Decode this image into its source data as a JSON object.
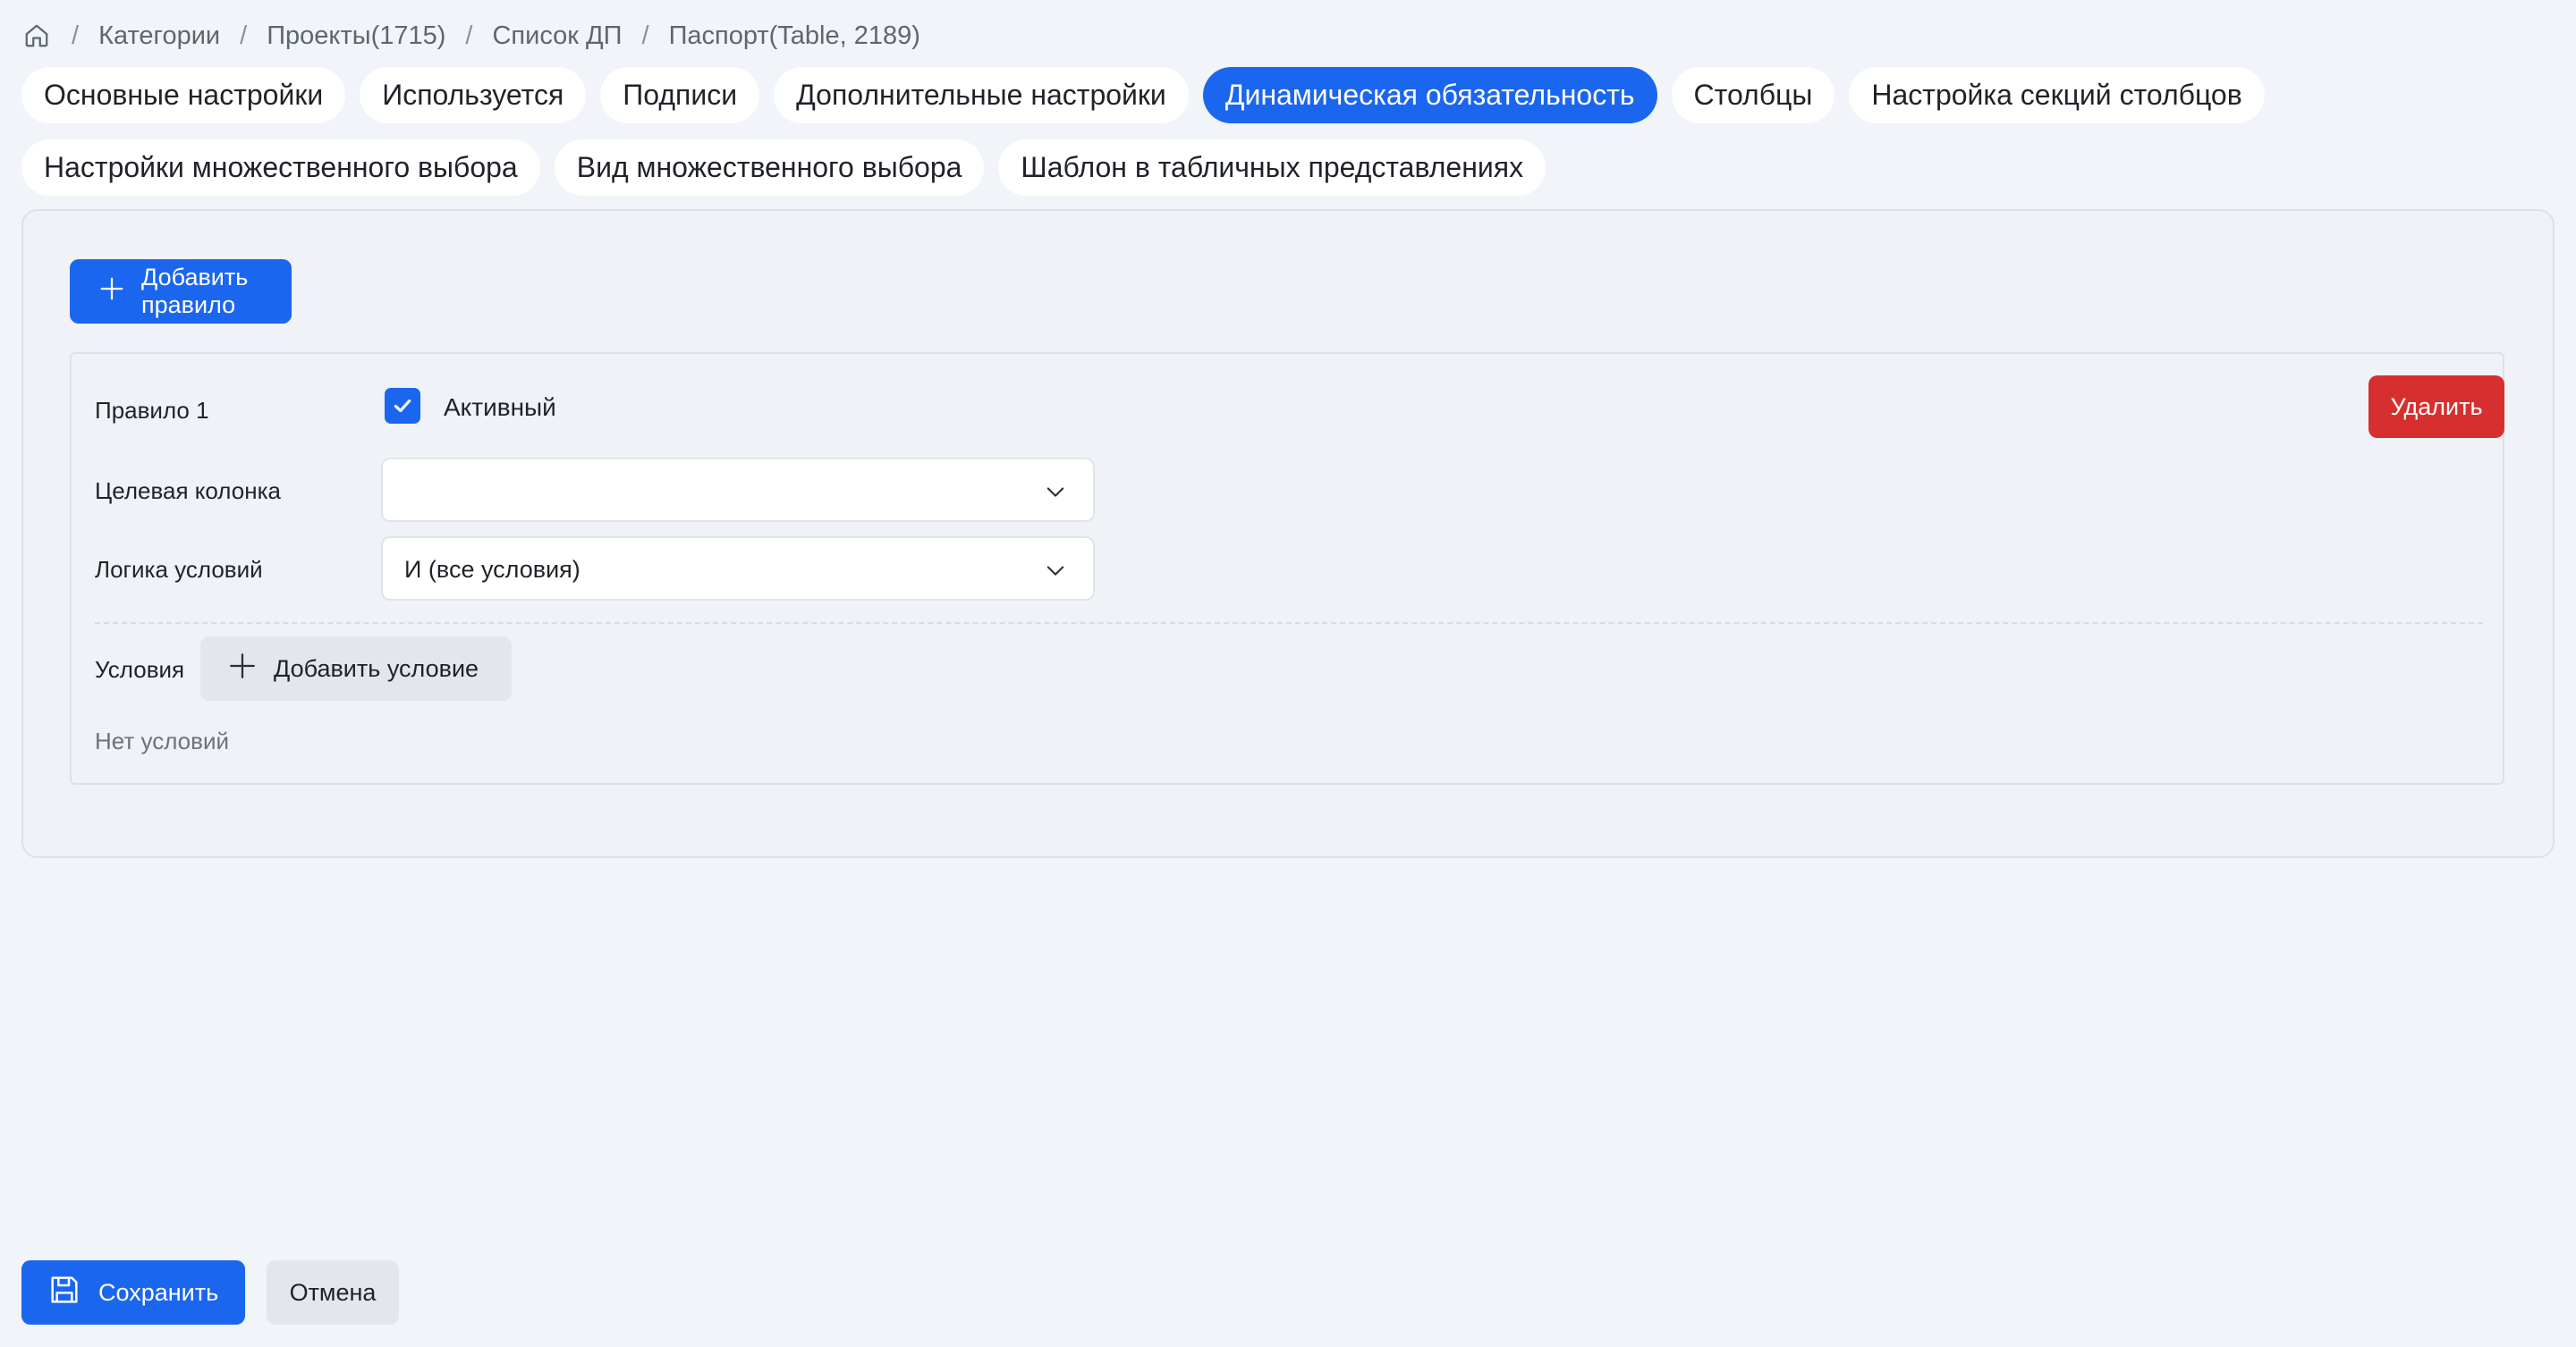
{
  "breadcrumb": {
    "home_icon": "home-icon",
    "items": [
      "Категории",
      "Проекты(1715)",
      "Список ДП",
      "Паспорт(Table, 2189)"
    ],
    "separator": "/"
  },
  "tabs": [
    {
      "label": "Основные настройки",
      "active": false
    },
    {
      "label": "Используется",
      "active": false
    },
    {
      "label": "Подписи",
      "active": false
    },
    {
      "label": "Дополнительные настройки",
      "active": false
    },
    {
      "label": "Динамическая обязательность",
      "active": true
    },
    {
      "label": "Столбцы",
      "active": false
    },
    {
      "label": "Настройка секций столбцов",
      "active": false
    },
    {
      "label": "Настройки множественного выбора",
      "active": false
    },
    {
      "label": "Вид множественного выбора",
      "active": false
    },
    {
      "label": "Шаблон в табличных представлениях",
      "active": false
    }
  ],
  "panel": {
    "add_rule_label": "Добавить правило",
    "rule": {
      "title": "Правило 1",
      "active_label": "Активный",
      "active_checked": true,
      "delete_label": "Удалить",
      "target_column_label": "Целевая колонка",
      "target_column_value": "",
      "logic_label": "Логика условий",
      "logic_value": "И (все условия)",
      "conditions_label": "Условия",
      "add_condition_label": "Добавить условие",
      "no_conditions_text": "Нет условий"
    }
  },
  "footer": {
    "save_label": "Сохранить",
    "cancel_label": "Отмена"
  },
  "colors": {
    "accent": "#1b66ee",
    "danger": "#d72f2f",
    "background": "#f1f4f8"
  }
}
